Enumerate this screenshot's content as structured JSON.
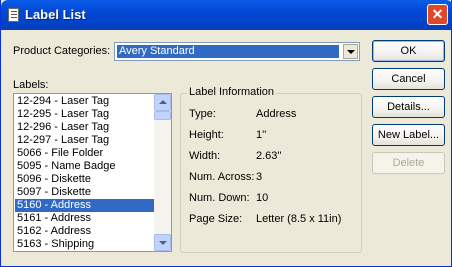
{
  "window": {
    "title": "Label List",
    "close_glyph": "✕"
  },
  "product_categories": {
    "label": "Product Categories:",
    "value": "Avery Standard"
  },
  "labels": {
    "label": "Labels:",
    "items": [
      "12-294 - Laser Tag",
      "12-295 - Laser Tag",
      "12-296 - Laser Tag",
      "12-297 - Laser Tag",
      "5066 - File Folder",
      "5095 - Name Badge",
      "5096 - Diskette",
      "5097 - Diskette",
      "5160 - Address",
      "5161 - Address",
      "5162 - Address",
      "5163 - Shipping"
    ],
    "selected_index": 8
  },
  "label_information": {
    "title": "Label Information",
    "rows": [
      {
        "key": "Type:",
        "value": "Address"
      },
      {
        "key": "Height:",
        "value": "1''"
      },
      {
        "key": "Width:",
        "value": "2.63''"
      },
      {
        "key": "Num. Across:",
        "value": "3"
      },
      {
        "key": "Num. Down:",
        "value": "10"
      },
      {
        "key": "Page Size:",
        "value": "Letter (8.5 x 11in)"
      }
    ]
  },
  "buttons": {
    "ok": "OK",
    "cancel": "Cancel",
    "details": "Details...",
    "new_label": "New Label...",
    "delete": "Delete"
  }
}
